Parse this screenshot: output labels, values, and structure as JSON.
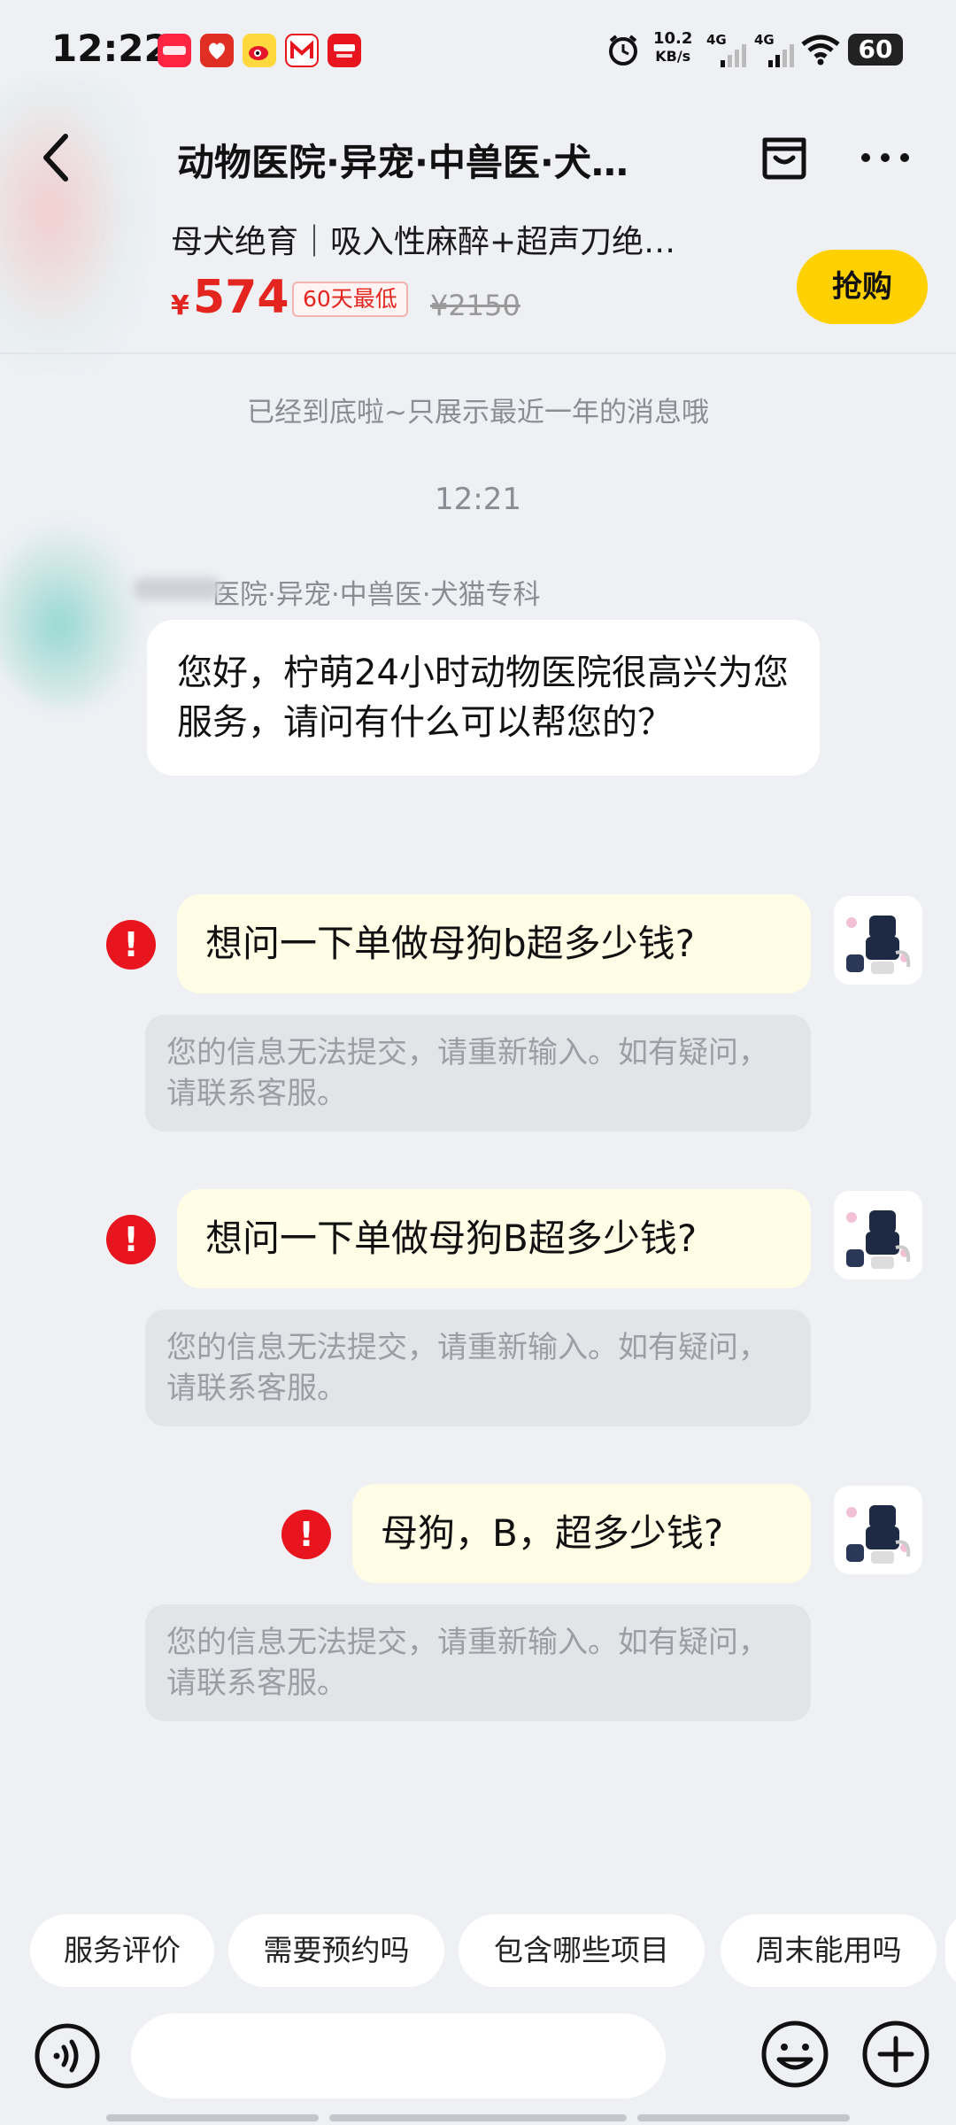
{
  "status_bar": {
    "time": "12:22",
    "network_speed_value": "10.2",
    "network_speed_unit": "KB/s",
    "signal1_label": "4G",
    "signal2_label": "4G",
    "battery": "60",
    "app_icons": [
      "xiaohongshu-icon",
      "pinduoduo-icon",
      "weibo-icon",
      "meituan-icon",
      "baike-icon"
    ]
  },
  "header": {
    "shop_title": "动物医院·异宠·中兽医·犬…"
  },
  "product": {
    "name": "母犬绝育｜吸入性麻醉+超声刀绝…",
    "price_symbol": "¥",
    "price": "574",
    "price_badge": "60天最低",
    "original_price": "¥2150",
    "buy_label": "抢购"
  },
  "chat": {
    "history_notice": "已经到底啦~只展示最近一年的消息哦",
    "timestamp": "12:21",
    "sender_name": "医院·异宠·中兽医·犬猫专科",
    "shop_message": "您好，柠萌24小时动物医院很高兴为您服务，请问有什么可以帮您的？",
    "user_messages": [
      {
        "text": "想问一下单做母狗b超多少钱?",
        "error": "!",
        "fail_notice": "您的信息无法提交，请重新输入。如有疑问，请联系客服。"
      },
      {
        "text": "想问一下单做母狗B超多少钱?",
        "error": "!",
        "fail_notice": "您的信息无法提交，请重新输入。如有疑问，请联系客服。"
      },
      {
        "text": "母狗，B，超多少钱?",
        "error": "!",
        "fail_notice": "您的信息无法提交，请重新输入。如有疑问，请联系客服。"
      }
    ]
  },
  "quick_replies": [
    "服务评价",
    "需要预约吗",
    "包含哪些项目",
    "周末能用吗"
  ],
  "input": {
    "placeholder": ""
  },
  "colors": {
    "accent_yellow": "#ffd100",
    "price_red": "#e4251f",
    "error_red": "#e8141e",
    "page_bg": "#eef0f4",
    "user_bubble": "#fffde6"
  }
}
